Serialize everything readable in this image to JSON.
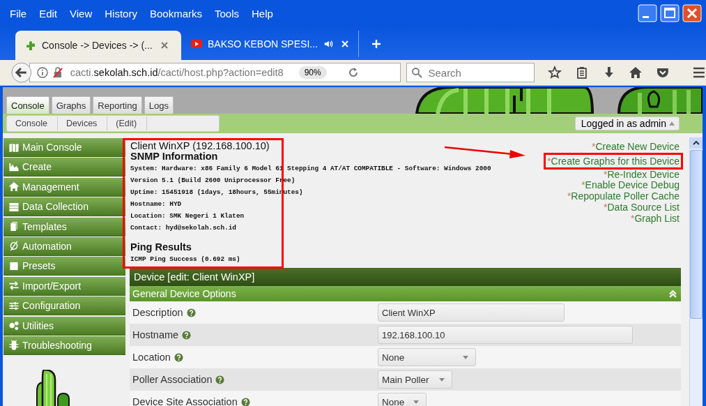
{
  "menu": [
    "File",
    "Edit",
    "View",
    "History",
    "Bookmarks",
    "Tools",
    "Help"
  ],
  "browser_tabs": [
    {
      "title": "Console -> Devices -> (...",
      "selected": true,
      "kind": "cactus"
    },
    {
      "title": "BAKSO KEBON SPESI...",
      "selected": false,
      "kind": "video"
    }
  ],
  "address": {
    "host_prefix": "cacti.",
    "domain": "sekolah.sch.id",
    "path": "/cacti/host.php?action=edit8",
    "zoom": "90%"
  },
  "search": {
    "placeholder": "Search"
  },
  "cacti_tabs": [
    {
      "label": "Console",
      "selected": true
    },
    {
      "label": "Graphs",
      "selected": false
    },
    {
      "label": "Reporting",
      "selected": false
    },
    {
      "label": "Logs",
      "selected": false
    }
  ],
  "breadcrumb": [
    "Console",
    "Devices",
    "(Edit)"
  ],
  "user_menu": "Logged in as admin",
  "sidebar": [
    {
      "label": "Main Console",
      "kind": "map"
    },
    {
      "label": "Create",
      "kind": "chart"
    },
    {
      "label": "Management",
      "kind": "house"
    },
    {
      "label": "Data Collection",
      "kind": "database"
    },
    {
      "label": "Templates",
      "kind": "pages"
    },
    {
      "label": "Automation",
      "kind": "slash"
    },
    {
      "label": "Presets",
      "kind": "square"
    },
    {
      "label": "Import/Export",
      "kind": "arrows"
    },
    {
      "label": "Configuration",
      "kind": "sliders"
    },
    {
      "label": "Utilities",
      "kind": "gears"
    },
    {
      "label": "Troubleshooting",
      "kind": "bug"
    }
  ],
  "device_title": "Client WinXP (192.168.100.10)",
  "snmp": {
    "heading": "SNMP Information",
    "lines": [
      "System: Hardware: x86 Family 6 Model 61 Stepping 4 AT/AT COMPATIBLE - Software: Windows 2000",
      "Version 5.1 (Build 2600 Uniprocessor Free)",
      "Uptime: 15451918 (1days, 18hours, 55minutes)",
      "Hostname: HYD",
      "Location: SMK Negeri 1 Klaten",
      "Contact: hyd@sekolah.sch.id"
    ]
  },
  "ping": {
    "heading": "Ping Results",
    "result": "ICMP Ping Success (0.692 ms)"
  },
  "actions": [
    {
      "mark": "*",
      "label": "Create New Device",
      "highlighted": false
    },
    {
      "mark": "*",
      "label": "Create Graphs for this Device",
      "highlighted": true
    },
    {
      "mark": "*",
      "label": "Re-Index Device",
      "highlighted": false
    },
    {
      "mark": "*",
      "label": "Enable Device Debug",
      "highlighted": false
    },
    {
      "mark": "*",
      "label": "Repopulate Poller Cache",
      "highlighted": false
    },
    {
      "mark": "*",
      "label": "Data Source List",
      "highlighted": false
    },
    {
      "mark": "*",
      "label": "Graph List",
      "highlighted": false
    }
  ],
  "form": {
    "title": "Device [edit: Client WinXP]",
    "section": "General Device Options",
    "fields": [
      {
        "label": "Description",
        "kind": "text",
        "value": "Client WinXP"
      },
      {
        "label": "Hostname",
        "kind": "text",
        "value": "192.168.100.10"
      },
      {
        "label": "Location",
        "kind": "select",
        "value": "None"
      },
      {
        "label": "Poller Association",
        "kind": "select",
        "value": "Main Poller"
      },
      {
        "label": "Device Site Association",
        "kind": "select",
        "value": "None"
      }
    ]
  }
}
